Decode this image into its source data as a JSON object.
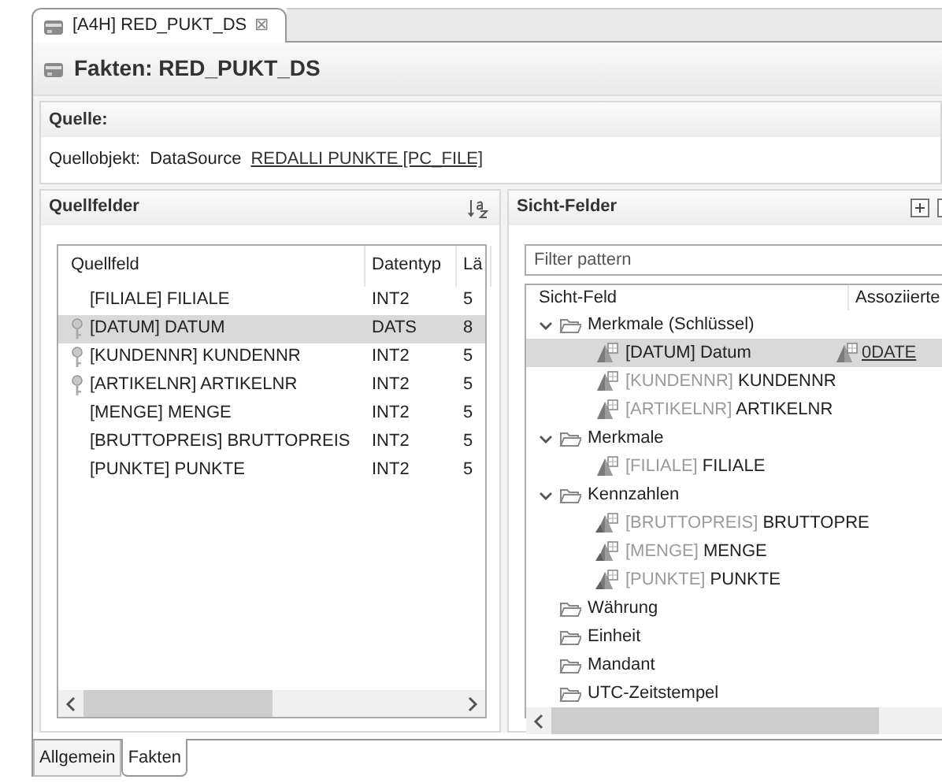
{
  "editor_tab": {
    "title": "[A4H] RED_PUKT_DS",
    "close": "⊠"
  },
  "header": {
    "title": "Fakten: RED_PUKT_DS"
  },
  "source_section": {
    "title": "Quelle:",
    "label": "Quellobjekt:",
    "type": "DataSource",
    "link": "REDALLI PUNKTE [PC_FILE]"
  },
  "source_fields": {
    "title": "Quellfelder",
    "columns": [
      "Quellfeld",
      "Datentyp",
      "Lä"
    ],
    "rows": [
      {
        "cells": [
          "[FILIALE] FILIALE",
          "INT2",
          "5"
        ],
        "key": false,
        "selected": false
      },
      {
        "cells": [
          "[DATUM] DATUM",
          "DATS",
          "8"
        ],
        "key": true,
        "selected": true
      },
      {
        "cells": [
          "[KUNDENNR] KUNDENNR",
          "INT2",
          "5"
        ],
        "key": true,
        "selected": false
      },
      {
        "cells": [
          "[ARTIKELNR] ARTIKELNR",
          "INT2",
          "5"
        ],
        "key": true,
        "selected": false
      },
      {
        "cells": [
          "[MENGE] MENGE",
          "INT2",
          "5"
        ],
        "key": false,
        "selected": false
      },
      {
        "cells": [
          "[BRUTTOPREIS] BRUTTOPREIS",
          "INT2",
          "5"
        ],
        "key": false,
        "selected": false
      },
      {
        "cells": [
          "[PUNKTE] PUNKTE",
          "INT2",
          "5"
        ],
        "key": false,
        "selected": false
      }
    ]
  },
  "view_fields": {
    "title": "Sicht-Felder",
    "filter": {
      "placeholder": "Filter pattern"
    },
    "columns": [
      "Sicht-Feld",
      "Assoziierte"
    ],
    "tree": [
      {
        "label": "Merkmale (Schlüssel)",
        "expanded": true,
        "children": [
          {
            "kind": "characteristic",
            "tech": "[DATUM]",
            "name": "Datum",
            "dimmed": false,
            "selected": true,
            "associated": "0DATE"
          },
          {
            "kind": "characteristic",
            "tech": "[KUNDENNR]",
            "name": "KUNDENNR",
            "dimmed": true,
            "selected": false
          },
          {
            "kind": "characteristic",
            "tech": "[ARTIKELNR]",
            "name": "ARTIKELNR",
            "dimmed": true,
            "selected": false
          }
        ]
      },
      {
        "label": "Merkmale",
        "expanded": true,
        "children": [
          {
            "kind": "characteristic",
            "tech": "[FILIALE]",
            "name": "FILIALE",
            "dimmed": true,
            "selected": false
          }
        ]
      },
      {
        "label": "Kennzahlen",
        "expanded": true,
        "children": [
          {
            "kind": "keyfigure",
            "tech": "[BRUTTOPREIS]",
            "name": "BRUTTOPRE",
            "dimmed": true,
            "selected": false
          },
          {
            "kind": "keyfigure",
            "tech": "[MENGE]",
            "name": "MENGE",
            "dimmed": true,
            "selected": false
          },
          {
            "kind": "keyfigure",
            "tech": "[PUNKTE]",
            "name": "PUNKTE",
            "dimmed": true,
            "selected": false
          }
        ]
      },
      {
        "label": "Währung"
      },
      {
        "label": "Einheit"
      },
      {
        "label": "Mandant"
      },
      {
        "label": "UTC-Zeitstempel"
      }
    ]
  },
  "bottom_tabs": [
    {
      "label": "Allgemein",
      "selected": false
    },
    {
      "label": "Fakten",
      "selected": true
    }
  ]
}
